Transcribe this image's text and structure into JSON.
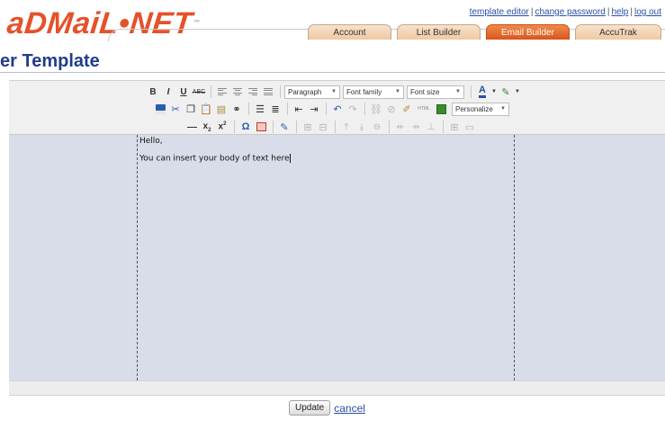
{
  "header": {
    "logo_text": "aDMaiL•NET",
    "logo_tm": "™",
    "links": [
      "template editor",
      "change password",
      "help",
      "log out"
    ]
  },
  "tabs": [
    {
      "label": "Account",
      "active": false
    },
    {
      "label": "List Builder",
      "active": false
    },
    {
      "label": "Email Builder",
      "active": true
    },
    {
      "label": "AccuTrak",
      "active": false
    }
  ],
  "page": {
    "title": "er Template"
  },
  "toolbar": {
    "bold": "B",
    "italic": "I",
    "underline": "U",
    "strikethrough": "ABC",
    "format_select": "Paragraph",
    "font_family_select": "Font family",
    "font_size_select": "Font size",
    "personalize_select": "Personalize",
    "html_button": "HTML",
    "text_color": "A",
    "omega": "Ω"
  },
  "editor": {
    "lines": [
      "Hello,",
      "You can insert your body of text here"
    ]
  },
  "actions": {
    "update_label": "Update",
    "cancel_label": "cancel"
  },
  "colors": {
    "brand_orange": "#e4522b",
    "title_blue": "#223c8c",
    "editor_bg": "#d9dde9",
    "active_tab": "#d9561a"
  }
}
